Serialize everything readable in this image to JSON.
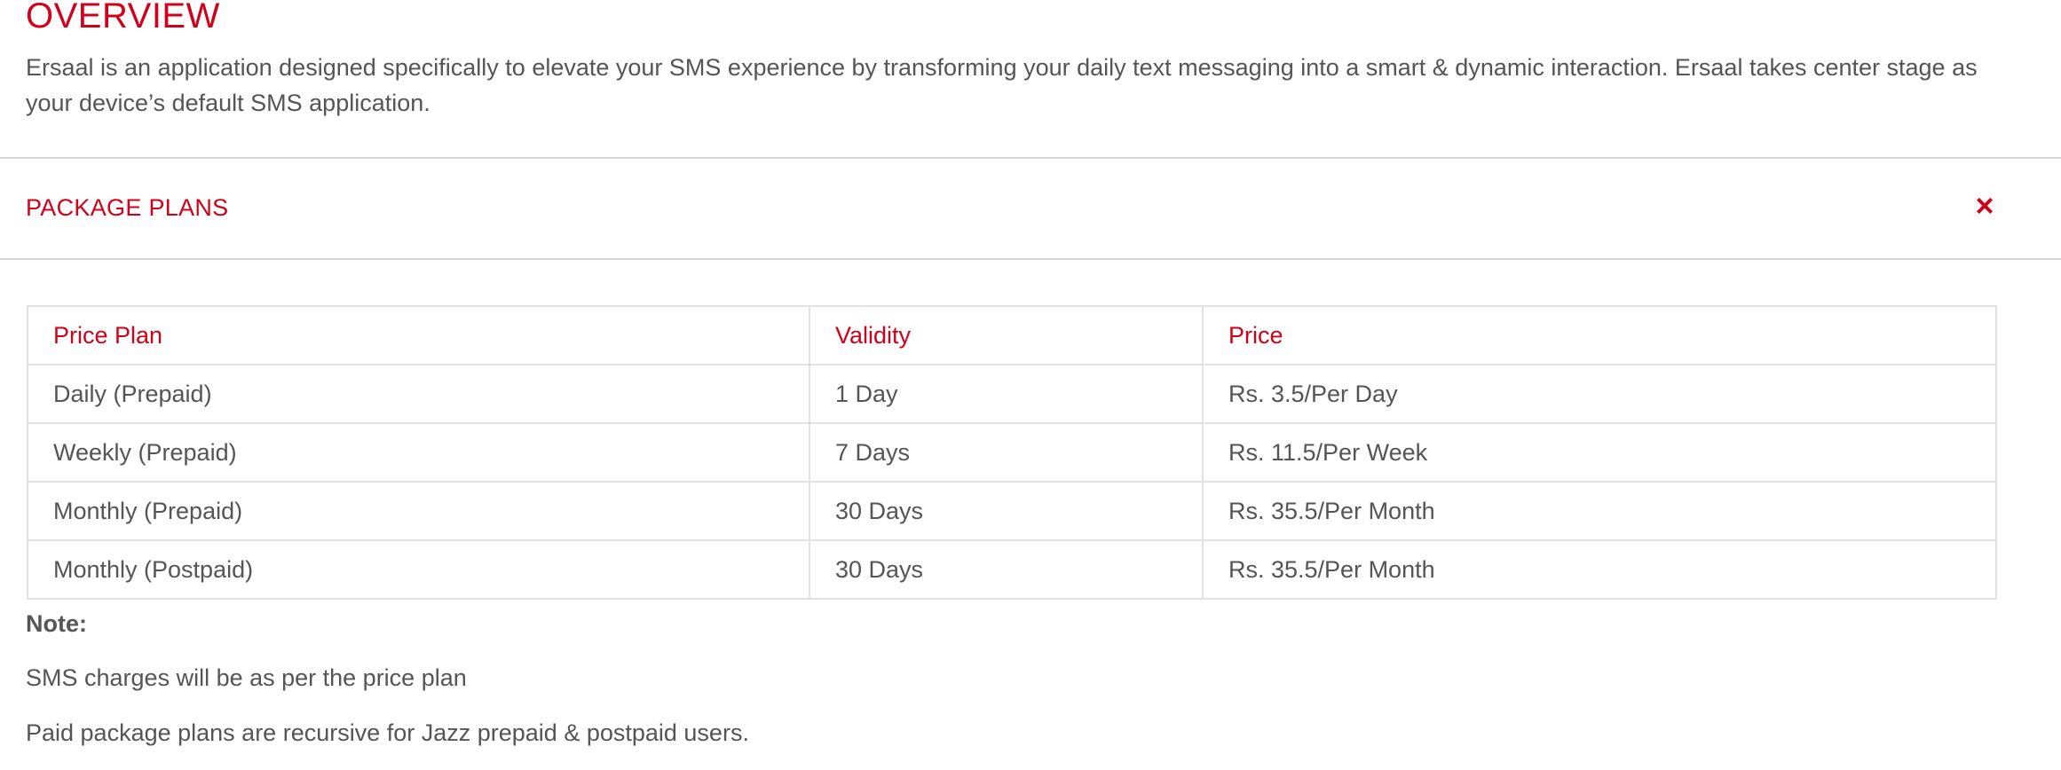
{
  "overview": {
    "title": "OVERVIEW",
    "text": "Ersaal is an application designed specifically to elevate your SMS experience by transforming your daily text messaging into a smart & dynamic interaction. Ersaal takes center stage as your device’s default SMS application."
  },
  "package_plans": {
    "title": "PACKAGE PLANS",
    "close_icon": "×",
    "table": {
      "headers": [
        "Price Plan",
        "Validity",
        "Price"
      ],
      "rows": [
        [
          "Daily (Prepaid)",
          "1 Day",
          "Rs. 3.5/Per Day"
        ],
        [
          "Weekly (Prepaid)",
          "7 Days",
          "Rs. 11.5/Per Week"
        ],
        [
          "Monthly (Prepaid)",
          "30 Days",
          "Rs. 35.5/Per Month"
        ],
        [
          "Monthly (Postpaid)",
          "30 Days",
          "Rs. 35.5/Per Month"
        ]
      ]
    },
    "note": {
      "label": "Note:",
      "lines": [
        "SMS charges will be as per the price plan",
        "Paid package plans are recursive for Jazz prepaid & postpaid users."
      ]
    }
  },
  "colors": {
    "accent": "#d0011b",
    "text": "#555555",
    "border": "#e2e2e2"
  }
}
